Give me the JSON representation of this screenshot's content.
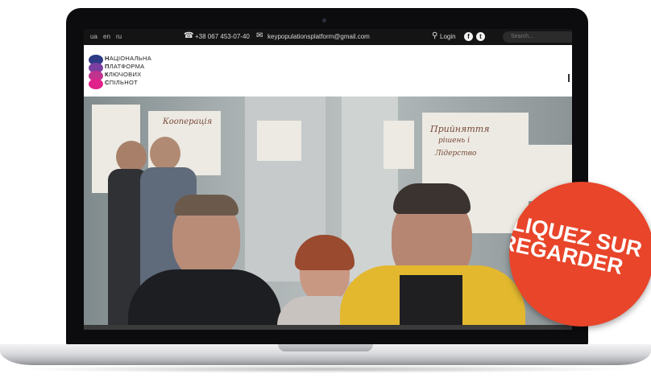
{
  "topbar": {
    "languages": [
      "ua",
      "en",
      "ru"
    ],
    "phone": "+38 067 453-07-40",
    "email": "keypopulationsplatform@gmail.com",
    "login": "Login",
    "social": [
      "f",
      "t"
    ],
    "search_placeholder": "Search..."
  },
  "logo": {
    "lines": [
      {
        "initial": "Н",
        "rest": "АЦІОНАЛЬНА"
      },
      {
        "initial": "П",
        "rest": "ЛАТФОРМА"
      },
      {
        "initial": "К",
        "rest": "ЛЮЧОВИХ"
      },
      {
        "initial": "С",
        "rest": "ПІЛЬНОТ"
      }
    ],
    "colors": [
      "#2e3a86",
      "#7a3fa0",
      "#c0338f",
      "#e0218a"
    ]
  },
  "hero": {
    "sign_text_1": "Кооперація",
    "sign_text_2": "Прийняття",
    "sign_text_3": "рішень і",
    "sign_text_4": "Лідерство"
  },
  "badge": {
    "line1": "CLIQUEZ SUR",
    "line2": "REGARDER",
    "color": "#e8452a"
  }
}
